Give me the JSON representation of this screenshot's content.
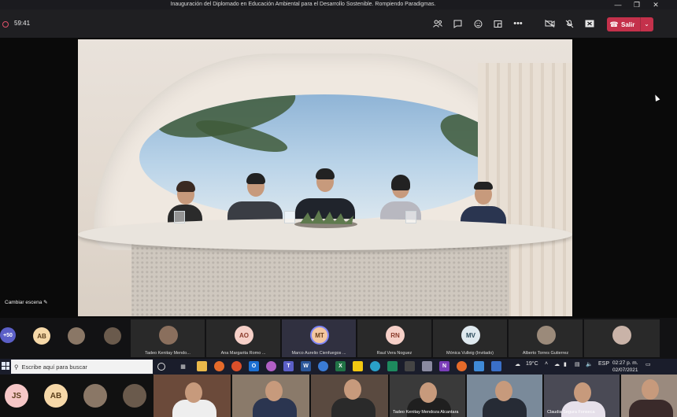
{
  "window": {
    "title": "Inauguración del Diplomado en Educación Ambiental para el Desarrollo Sostenible. Rompiendo Paradigmas.",
    "controls": [
      "minimize-icon",
      "restore-icon",
      "close-icon"
    ]
  },
  "toolbar": {
    "timer": "59:41",
    "icons": [
      "people-icon",
      "chat-icon",
      "reactions-icon",
      "rooms-icon",
      "more-icon",
      "camera-off-icon",
      "mic-off-icon",
      "share-icon"
    ],
    "leave_label": "Salir",
    "accent": "#c4314b"
  },
  "stage": {
    "change_scene_label": "Cambiar escena"
  },
  "strip": {
    "overflow_count": "+50",
    "mini": [
      {
        "initials": "AB",
        "color": "#f6d8a8"
      }
    ],
    "tiles": [
      {
        "name": "Tadeo Kenitay Mendo...",
        "type": "photo"
      },
      {
        "name": "Ana Margarita Romo ...",
        "initials": "AO",
        "color": "#f6d0c8"
      },
      {
        "name": "Marco Aurelio Cienfuegos ...",
        "initials": "MT",
        "color": "#f3c7a0",
        "active": true
      },
      {
        "name": "Raul Vera Noguez",
        "initials": "RN",
        "color": "#f6d0c8"
      },
      {
        "name": "Mónica Vulleig (Invitado)",
        "initials": "MV",
        "color": "#dfe9ef"
      },
      {
        "name": "Alberto Torres Gutierrez",
        "type": "photo"
      }
    ]
  },
  "taskbar": {
    "search_placeholder": "Escribe aquí para buscar",
    "weather": "19°C",
    "language": "ESP",
    "time": "02:27 p. m.",
    "date": "02/07/2021"
  },
  "gallery": {
    "avatars": [
      {
        "initials": "JS",
        "color": "#f6c7c7"
      },
      {
        "initials": "AB",
        "color": "#f6d8a8"
      }
    ],
    "tiles": [
      {
        "name": "Tadeo Kenitay Mendoza Alcantara"
      },
      {
        "name": "Claudia Segura Fonseca"
      }
    ]
  }
}
